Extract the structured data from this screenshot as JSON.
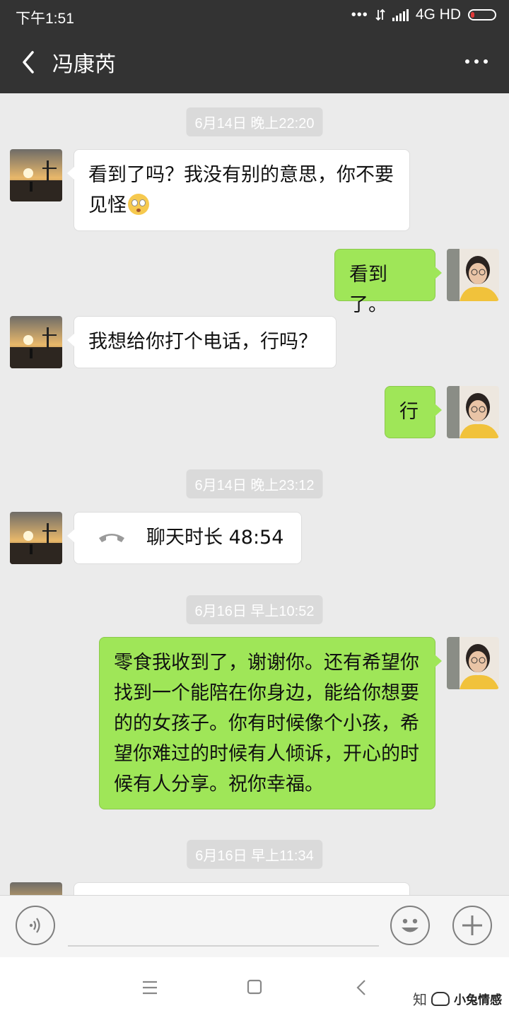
{
  "status_bar": {
    "time": "下午1:51",
    "network": "4G HD"
  },
  "header": {
    "title": "冯康芮"
  },
  "messages": {
    "ts1": "6月14日 晚上22:20",
    "m1": "看到了吗？我没有别的意思，你不要见怪",
    "m2": "看到了。",
    "m3": "我想给你打个电话，行吗？",
    "m4": "行",
    "ts2": "6月14日 晚上23:12",
    "call": "聊天时长 48:54",
    "ts3": "6月16日 早上10:52",
    "m5": "零食我收到了，谢谢你。还有希望你找到一个能陪在你身边，能给你想要的的女孩子。你有时候像个小孩，希望你难过的时候有人倾诉，开心的时候有人分享。祝你幸福。",
    "ts4": "6月16日 早上11:34"
  },
  "watermark": {
    "zhi": "知",
    "brand": "小兔情感"
  },
  "colors": {
    "bubble_out": "#9fe658",
    "bubble_in": "#ffffff",
    "bar": "#333333"
  },
  "icons": [
    "back-icon",
    "more-icon",
    "phone-icon",
    "voice-icon",
    "emoji-icon",
    "plus-icon",
    "menu-icon",
    "home-icon",
    "nav-back-icon"
  ]
}
